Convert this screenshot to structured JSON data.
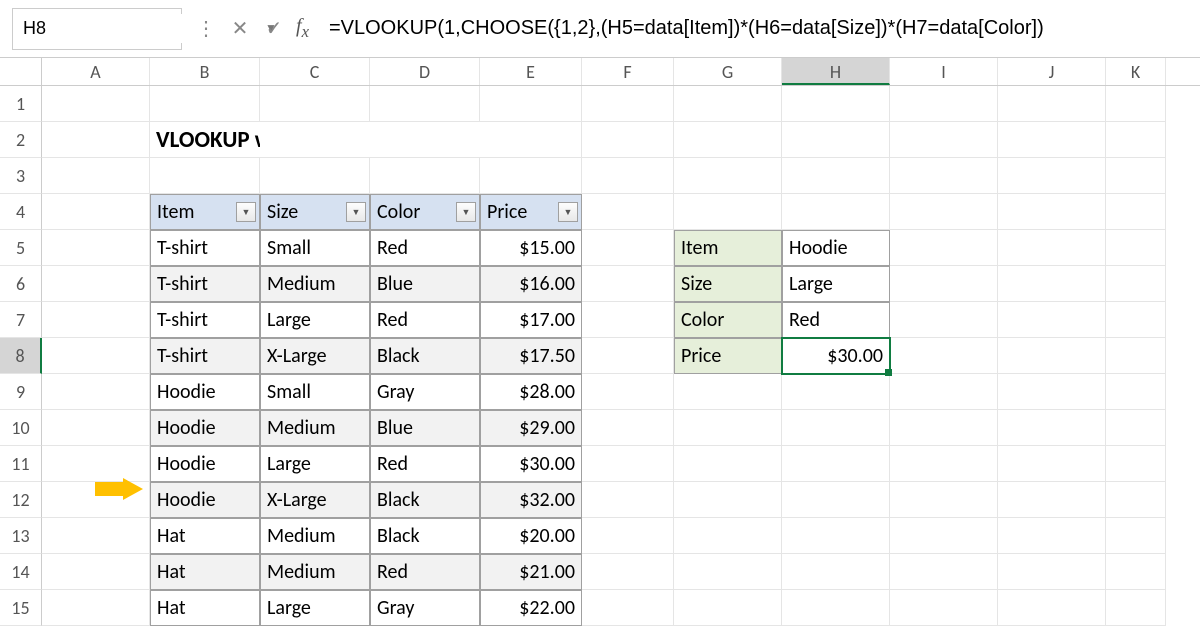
{
  "nameBox": "H8",
  "formula": "=VLOOKUP(1,CHOOSE({1,2},(H5=data[Item])*(H6=data[Size])*(H7=data[Color])",
  "title": "VLOOKUP with multiple criteria advanced",
  "columns": [
    "A",
    "B",
    "C",
    "D",
    "E",
    "F",
    "G",
    "H",
    "I",
    "J",
    "K"
  ],
  "rows": [
    "1",
    "2",
    "3",
    "4",
    "5",
    "6",
    "7",
    "8",
    "9",
    "10",
    "11",
    "12",
    "13",
    "14",
    "15"
  ],
  "activeCol": "H",
  "activeRow": "8",
  "tableHeaders": [
    "Item",
    "Size",
    "Color",
    "Price"
  ],
  "tableData": [
    {
      "item": "T-shirt",
      "size": "Small",
      "color": "Red",
      "price": "$15.00",
      "band": false
    },
    {
      "item": "T-shirt",
      "size": "Medium",
      "color": "Blue",
      "price": "$16.00",
      "band": true
    },
    {
      "item": "T-shirt",
      "size": "Large",
      "color": "Red",
      "price": "$17.00",
      "band": false
    },
    {
      "item": "T-shirt",
      "size": "X-Large",
      "color": "Black",
      "price": "$17.50",
      "band": true
    },
    {
      "item": "Hoodie",
      "size": "Small",
      "color": "Gray",
      "price": "$28.00",
      "band": false
    },
    {
      "item": "Hoodie",
      "size": "Medium",
      "color": "Blue",
      "price": "$29.00",
      "band": true
    },
    {
      "item": "Hoodie",
      "size": "Large",
      "color": "Red",
      "price": "$30.00",
      "band": false
    },
    {
      "item": "Hoodie",
      "size": "X-Large",
      "color": "Black",
      "price": "$32.00",
      "band": true
    },
    {
      "item": "Hat",
      "size": "Medium",
      "color": "Black",
      "price": "$20.00",
      "band": false
    },
    {
      "item": "Hat",
      "size": "Medium",
      "color": "Red",
      "price": "$21.00",
      "band": true
    },
    {
      "item": "Hat",
      "size": "Large",
      "color": "Gray",
      "price": "$22.00",
      "band": false
    }
  ],
  "lookup": {
    "item": {
      "label": "Item",
      "value": "Hoodie"
    },
    "size": {
      "label": "Size",
      "value": "Large"
    },
    "color": {
      "label": "Color",
      "value": "Red"
    },
    "price": {
      "label": "Price",
      "value": "$30.00"
    }
  }
}
